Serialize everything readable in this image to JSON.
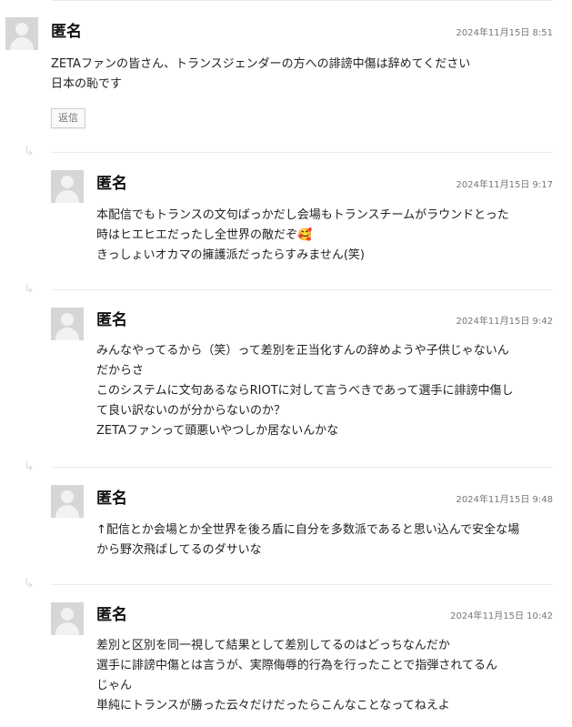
{
  "comments": [
    {
      "author": "匿名",
      "date": "2024年11月15日 8:51",
      "lines": [
        "ZETAファンの皆さん、トランスジェンダーの方への誹謗中傷は辞めてください",
        "日本の恥です"
      ],
      "reply_label": "返信"
    },
    {
      "author": "匿名",
      "date": "2024年11月15日 9:17",
      "lines": [
        "本配信でもトランスの文句ばっかだし会場もトランスチームがラウンドとった",
        "時はヒエヒエだったし全世界の敵だぞ🥰",
        "きっしょいオカマの擁護派だったらすみません(笑)"
      ]
    },
    {
      "author": "匿名",
      "date": "2024年11月15日 9:42",
      "lines": [
        "みんなやってるから（笑）って差別を正当化すんの辞めようや子供じゃないん",
        "だからさ",
        "このシステムに文句あるならRIOTに対して言うべきであって選手に誹謗中傷し",
        "て良い訳ないのが分からないのか？",
        "ZETAファンって頭悪いやつしか居ないんかな"
      ]
    },
    {
      "author": "匿名",
      "date": "2024年11月15日 9:48",
      "lines": [
        "↑配信とか会場とか全世界を後ろ盾に自分を多数派であると思い込んで安全な場",
        "から野次飛ばしてるのダサいな"
      ]
    },
    {
      "author": "匿名",
      "date": "2024年11月15日 10:42",
      "lines": [
        "差別と区別を同一視して結果として差別してるのはどっちなんだか",
        "選手に誹謗中傷とは言うが、実際侮辱的行為を行ったことで指弾されてるん",
        "じゃん",
        "単純にトランスが勝った云々だけだったらこんなことなってねえよ"
      ]
    }
  ]
}
